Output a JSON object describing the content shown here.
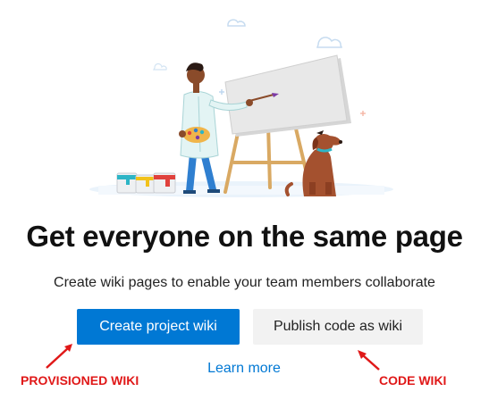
{
  "empty_state": {
    "headline": "Get everyone on the same page",
    "subtext": "Create wiki pages to enable your team members collaborate"
  },
  "actions": {
    "create_label": "Create project wiki",
    "publish_label": "Publish code as wiki",
    "learn_more": "Learn more"
  },
  "annotations": {
    "left": "PROVISIONED WIKI",
    "right": "CODE WIKI"
  },
  "colors": {
    "primary": "#0078d4",
    "annotation": "#e01818"
  },
  "icons": [
    "cloud-icon",
    "painter-figure",
    "canvas-easel",
    "paint-cans",
    "dog-figure",
    "arrow-icon"
  ]
}
